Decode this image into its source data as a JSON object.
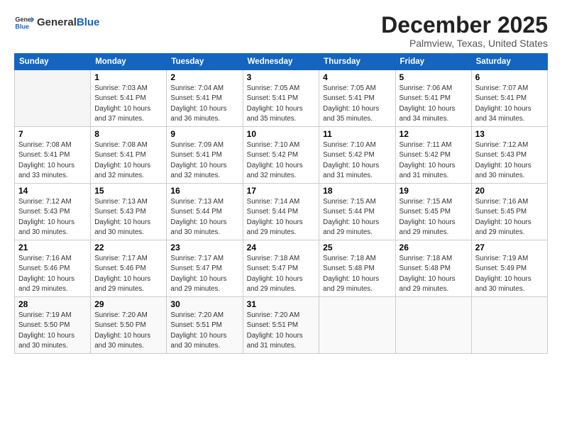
{
  "logo": {
    "general": "General",
    "blue": "Blue"
  },
  "title": "December 2025",
  "location": "Palmview, Texas, United States",
  "days_header": [
    "Sunday",
    "Monday",
    "Tuesday",
    "Wednesday",
    "Thursday",
    "Friday",
    "Saturday"
  ],
  "weeks": [
    [
      {
        "day": "",
        "info": ""
      },
      {
        "day": "1",
        "info": "Sunrise: 7:03 AM\nSunset: 5:41 PM\nDaylight: 10 hours\nand 37 minutes."
      },
      {
        "day": "2",
        "info": "Sunrise: 7:04 AM\nSunset: 5:41 PM\nDaylight: 10 hours\nand 36 minutes."
      },
      {
        "day": "3",
        "info": "Sunrise: 7:05 AM\nSunset: 5:41 PM\nDaylight: 10 hours\nand 35 minutes."
      },
      {
        "day": "4",
        "info": "Sunrise: 7:05 AM\nSunset: 5:41 PM\nDaylight: 10 hours\nand 35 minutes."
      },
      {
        "day": "5",
        "info": "Sunrise: 7:06 AM\nSunset: 5:41 PM\nDaylight: 10 hours\nand 34 minutes."
      },
      {
        "day": "6",
        "info": "Sunrise: 7:07 AM\nSunset: 5:41 PM\nDaylight: 10 hours\nand 34 minutes."
      }
    ],
    [
      {
        "day": "7",
        "info": "Sunrise: 7:08 AM\nSunset: 5:41 PM\nDaylight: 10 hours\nand 33 minutes."
      },
      {
        "day": "8",
        "info": "Sunrise: 7:08 AM\nSunset: 5:41 PM\nDaylight: 10 hours\nand 32 minutes."
      },
      {
        "day": "9",
        "info": "Sunrise: 7:09 AM\nSunset: 5:41 PM\nDaylight: 10 hours\nand 32 minutes."
      },
      {
        "day": "10",
        "info": "Sunrise: 7:10 AM\nSunset: 5:42 PM\nDaylight: 10 hours\nand 32 minutes."
      },
      {
        "day": "11",
        "info": "Sunrise: 7:10 AM\nSunset: 5:42 PM\nDaylight: 10 hours\nand 31 minutes."
      },
      {
        "day": "12",
        "info": "Sunrise: 7:11 AM\nSunset: 5:42 PM\nDaylight: 10 hours\nand 31 minutes."
      },
      {
        "day": "13",
        "info": "Sunrise: 7:12 AM\nSunset: 5:43 PM\nDaylight: 10 hours\nand 30 minutes."
      }
    ],
    [
      {
        "day": "14",
        "info": "Sunrise: 7:12 AM\nSunset: 5:43 PM\nDaylight: 10 hours\nand 30 minutes."
      },
      {
        "day": "15",
        "info": "Sunrise: 7:13 AM\nSunset: 5:43 PM\nDaylight: 10 hours\nand 30 minutes."
      },
      {
        "day": "16",
        "info": "Sunrise: 7:13 AM\nSunset: 5:44 PM\nDaylight: 10 hours\nand 30 minutes."
      },
      {
        "day": "17",
        "info": "Sunrise: 7:14 AM\nSunset: 5:44 PM\nDaylight: 10 hours\nand 29 minutes."
      },
      {
        "day": "18",
        "info": "Sunrise: 7:15 AM\nSunset: 5:44 PM\nDaylight: 10 hours\nand 29 minutes."
      },
      {
        "day": "19",
        "info": "Sunrise: 7:15 AM\nSunset: 5:45 PM\nDaylight: 10 hours\nand 29 minutes."
      },
      {
        "day": "20",
        "info": "Sunrise: 7:16 AM\nSunset: 5:45 PM\nDaylight: 10 hours\nand 29 minutes."
      }
    ],
    [
      {
        "day": "21",
        "info": "Sunrise: 7:16 AM\nSunset: 5:46 PM\nDaylight: 10 hours\nand 29 minutes."
      },
      {
        "day": "22",
        "info": "Sunrise: 7:17 AM\nSunset: 5:46 PM\nDaylight: 10 hours\nand 29 minutes."
      },
      {
        "day": "23",
        "info": "Sunrise: 7:17 AM\nSunset: 5:47 PM\nDaylight: 10 hours\nand 29 minutes."
      },
      {
        "day": "24",
        "info": "Sunrise: 7:18 AM\nSunset: 5:47 PM\nDaylight: 10 hours\nand 29 minutes."
      },
      {
        "day": "25",
        "info": "Sunrise: 7:18 AM\nSunset: 5:48 PM\nDaylight: 10 hours\nand 29 minutes."
      },
      {
        "day": "26",
        "info": "Sunrise: 7:18 AM\nSunset: 5:48 PM\nDaylight: 10 hours\nand 29 minutes."
      },
      {
        "day": "27",
        "info": "Sunrise: 7:19 AM\nSunset: 5:49 PM\nDaylight: 10 hours\nand 30 minutes."
      }
    ],
    [
      {
        "day": "28",
        "info": "Sunrise: 7:19 AM\nSunset: 5:50 PM\nDaylight: 10 hours\nand 30 minutes."
      },
      {
        "day": "29",
        "info": "Sunrise: 7:20 AM\nSunset: 5:50 PM\nDaylight: 10 hours\nand 30 minutes."
      },
      {
        "day": "30",
        "info": "Sunrise: 7:20 AM\nSunset: 5:51 PM\nDaylight: 10 hours\nand 30 minutes."
      },
      {
        "day": "31",
        "info": "Sunrise: 7:20 AM\nSunset: 5:51 PM\nDaylight: 10 hours\nand 31 minutes."
      },
      {
        "day": "",
        "info": ""
      },
      {
        "day": "",
        "info": ""
      },
      {
        "day": "",
        "info": ""
      }
    ]
  ]
}
